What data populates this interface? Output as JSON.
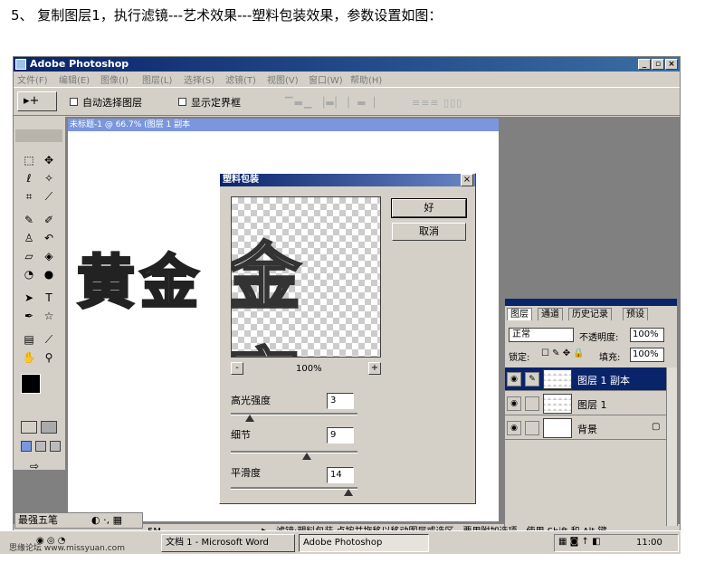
{
  "heading": "5、 复制图层1，执行滤镜---艺术效果---塑料包装效果，参数设置如图：",
  "app": {
    "title": "Adobe Photoshop",
    "window_buttons": [
      "_",
      "▫",
      "×"
    ]
  },
  "menu": [
    "文件(F)",
    "编辑(E)",
    "图像(I)",
    "图层(L)",
    "选择(S)",
    "滤镜(T)",
    "视图(V)",
    "窗口(W)",
    "帮助(H)"
  ],
  "options_bar": {
    "auto_select_layer": "自动选择图层",
    "show_bounding_box": "显示定界框"
  },
  "document": {
    "title": "未标题-1 @ 66.7% (图层 1 副本",
    "text": "黄金"
  },
  "dialog": {
    "title": "塑料包装",
    "ok": "好",
    "cancel": "取消",
    "zoom": "100%",
    "zoom_out": "-",
    "zoom_in": "+",
    "preview_text": "金 字",
    "params": [
      {
        "label": "高光强度",
        "value": "3",
        "level": 0.15
      },
      {
        "label": "细节",
        "value": "9",
        "level": 0.6
      },
      {
        "label": "平滑度",
        "value": "14",
        "level": 0.93
      }
    ]
  },
  "layers_panel": {
    "tabs": [
      "图层",
      "通道",
      "历史记录",
      "预设"
    ],
    "blend_mode": "正常",
    "opacity_label": "不透明度:",
    "opacity_value": "100%",
    "lock_label": "锁定:",
    "fill_label": "填充:",
    "fill_value": "100%",
    "layers": [
      {
        "name": "图层 1 副本",
        "selected": true
      },
      {
        "name": "图层 1",
        "selected": false
      },
      {
        "name": "背景",
        "selected": false
      }
    ]
  },
  "status_bar": {
    "doc_size": "5M",
    "hint": "滤镜:塑料包装  点按并拖移以移动图层或选区。要用附加选项，使用 Shift 和 Alt 键。"
  },
  "ime": "最强五笔",
  "taskbar": {
    "word_task": "文档 1 - Microsoft Word",
    "ps_task": "Adobe Photoshop",
    "clock": "11:00"
  },
  "watermark": "思缘论坛  www.missyuan.com"
}
